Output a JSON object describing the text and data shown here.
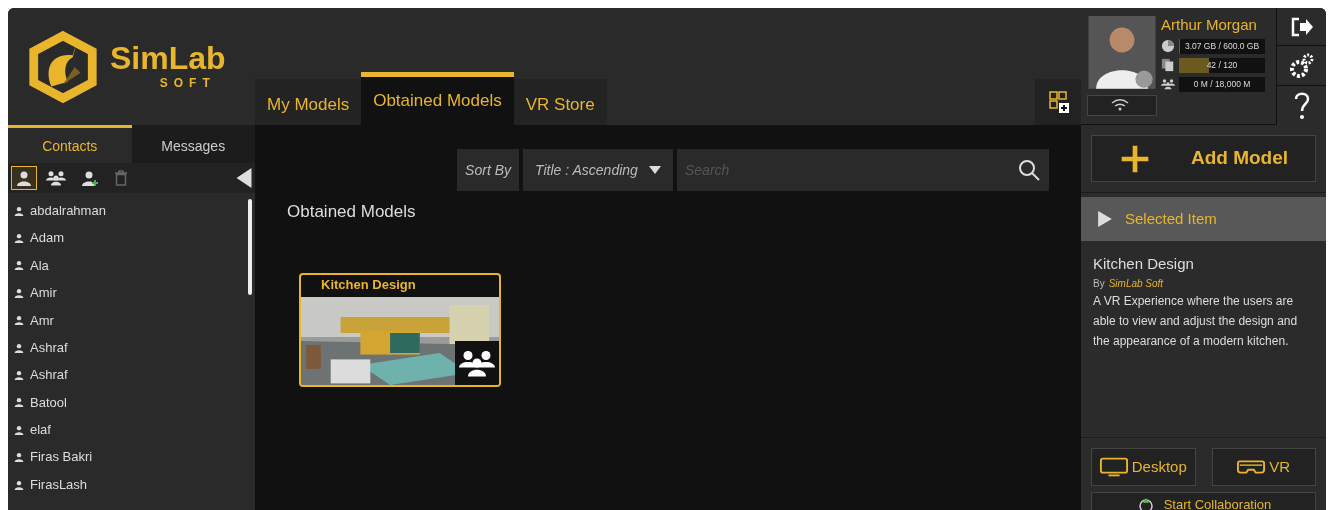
{
  "brand": {
    "name": "SimLab",
    "tagline": "SOFT"
  },
  "side_tabs": [
    {
      "label": "Contacts",
      "selected": true
    },
    {
      "label": "Messages",
      "selected": false
    }
  ],
  "contact_filters": [
    {
      "kind": "single",
      "selected": true
    },
    {
      "kind": "group",
      "selected": false
    },
    {
      "kind": "add",
      "selected": false
    },
    {
      "kind": "delete",
      "selected": false
    }
  ],
  "contacts": [
    "abdalrahman",
    "Adam",
    "Ala",
    "Amir",
    "Amr",
    "Ashraf",
    "Ashraf",
    "Batool",
    "elaf",
    "Firas Bakri",
    "FirasLash"
  ],
  "main_tabs": [
    {
      "label": "My Models",
      "selected": false
    },
    {
      "label": "Obtained Models",
      "selected": true
    },
    {
      "label": "VR Store",
      "selected": false
    }
  ],
  "sort": {
    "label": "Sort By",
    "value": "Title : Ascending"
  },
  "search": {
    "placeholder": "Search"
  },
  "section_title": "Obtained Models",
  "models": [
    {
      "title": "Kitchen Design",
      "kind": "picture",
      "shared": true
    }
  ],
  "user": {
    "name": "Arthur Morgan",
    "meters": [
      {
        "kind": "storage",
        "reading": "3.07 GB / 600.0 GB",
        "level": 0.005
      },
      {
        "kind": "files",
        "reading": "42 / 120",
        "level": 0.35
      },
      {
        "kind": "users",
        "reading": "0 M / 18,000 M"
      }
    ]
  },
  "add_model": "Add Model",
  "selected_item": {
    "header": "Selected Item",
    "title": "Kitchen Design",
    "by": "By",
    "author": "SimLab Soft",
    "description": "A VR Experience where the users are able to view and adjust the design and the appearance of a modern kitchen."
  },
  "launch_buttons": [
    {
      "kind": "desktop",
      "label": "Desktop"
    },
    {
      "kind": "vr",
      "label": "VR"
    }
  ],
  "collaboration": "Start Collaboration"
}
